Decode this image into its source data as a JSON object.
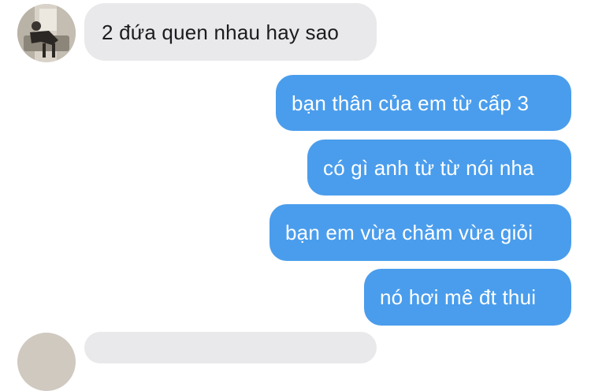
{
  "messages": [
    {
      "direction": "incoming",
      "text": "2 đứa quen nhau hay sao"
    },
    {
      "direction": "outgoing",
      "text": "bạn thân của em từ cấp 3"
    },
    {
      "direction": "outgoing",
      "text": "có gì anh từ từ nói nha"
    },
    {
      "direction": "outgoing",
      "text": "bạn em vừa chăm vừa giỏi"
    },
    {
      "direction": "outgoing",
      "text": "nó hơi mê đt thui"
    }
  ],
  "colors": {
    "outgoing_bubble": "#4a9dec",
    "incoming_bubble": "#e9e9ec",
    "outgoing_text": "#ffffff",
    "incoming_text": "#1c1c1e"
  }
}
